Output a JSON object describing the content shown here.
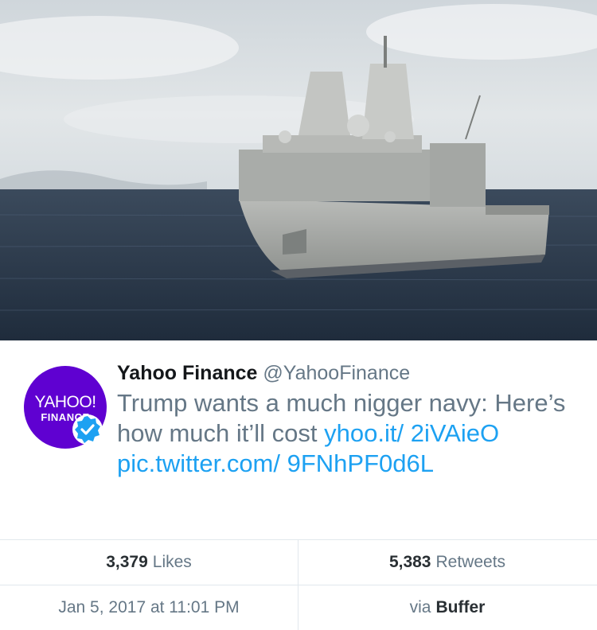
{
  "tweet": {
    "name": "Yahoo Finance",
    "handle": "@YahooFinance",
    "text_main": "Trump wants a much nigger navy: Here’s how much it’ll cost ",
    "link1": "yhoo.it/ 2iVAieO",
    "link2": "pic.twitter.com/ 9FNhPF0d6L",
    "avatar_line1": "YAHOO!",
    "avatar_line2": "FINANCE",
    "link_color": "#1da1f2",
    "avatar_color": "#5f01d1"
  },
  "stats": {
    "likes_count": "3,379",
    "likes_label": "Likes",
    "retweets_count": "5,383",
    "retweets_label": "Retweets",
    "timestamp": "Jan 5, 2017 at 11:01 PM",
    "via_label": "via",
    "via_app": "Buffer"
  },
  "icons": {
    "verified": "verified-badge-icon"
  }
}
